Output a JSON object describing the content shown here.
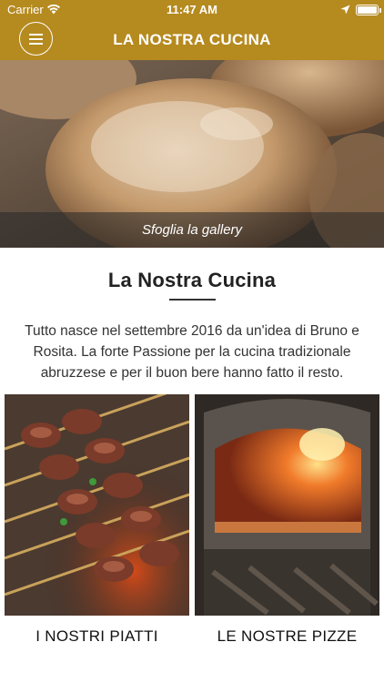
{
  "status_bar": {
    "carrier": "Carrier",
    "time": "11:47 AM"
  },
  "header": {
    "title": "LA NOSTRA CUCINA"
  },
  "hero": {
    "caption": "Sfoglia la gallery"
  },
  "section": {
    "title": "La Nostra Cucina",
    "intro": "Tutto nasce nel settembre 2016 da un'idea di Bruno e Rosita. La forte Passione per la cucina tradizionale abruzzese e per il buon bere hanno fatto il resto."
  },
  "tiles": [
    {
      "label": "I NOSTRI PIATTI"
    },
    {
      "label": "LE NOSTRE PIZZE"
    }
  ],
  "colors": {
    "accent": "#b58a1f"
  }
}
